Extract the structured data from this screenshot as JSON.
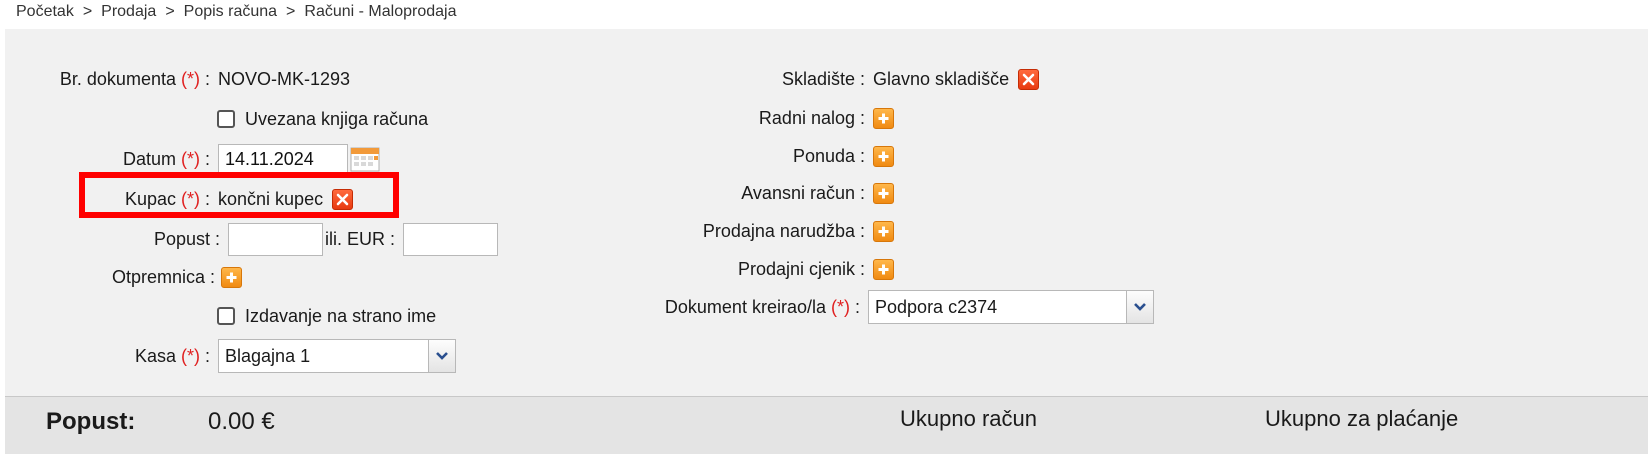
{
  "breadcrumb": [
    "Početak",
    "Prodaja",
    "Popis računa",
    "Računi - Maloprodaja"
  ],
  "breadcrumb_sep": ">",
  "required_mark": "(*)",
  "form_left": {
    "doc_number": {
      "label": "Br. dokumenta",
      "value": "NOVO-MK-1293"
    },
    "bound_book": {
      "label": "Uvezana knjiga računa",
      "checked": false
    },
    "date": {
      "label": "Datum",
      "value": "14.11.2024"
    },
    "customer": {
      "label": "Kupac",
      "value": "končni kupec"
    },
    "discount": {
      "label": "Popust",
      "value": "",
      "or_label": "ili. EUR",
      "eur_value": ""
    },
    "delivery_note": {
      "label": "Otpremnica"
    },
    "foreign_name": {
      "label": "Izdavanje na strano ime",
      "checked": false
    },
    "cash_register": {
      "label": "Kasa",
      "value": "Blagajna 1"
    }
  },
  "form_right": {
    "warehouse": {
      "label": "Skladište",
      "value": "Glavno skladišče"
    },
    "work_order": {
      "label": "Radni nalog"
    },
    "quote": {
      "label": "Ponuda"
    },
    "advance_invoice": {
      "label": "Avansni račun"
    },
    "sales_order": {
      "label": "Prodajna narudžba"
    },
    "price_list": {
      "label": "Prodajni cjenik"
    },
    "created_by": {
      "label": "Dokument kreirao/la",
      "value": "Podpora c2374"
    }
  },
  "footer": {
    "discount_label": "Popust:",
    "discount_value": "0.00 €",
    "total_invoice": "Ukupno račun",
    "total_payment": "Ukupno za plaćanje"
  },
  "colors": {
    "required": "#e02020",
    "highlight": "#ff0000",
    "remove_icon": "#e83a10",
    "add_icon": "#f08a12"
  },
  "icons": {
    "remove": "remove-icon",
    "add": "add-icon",
    "calendar": "calendar-icon",
    "dropdown": "chevron-down-icon"
  }
}
